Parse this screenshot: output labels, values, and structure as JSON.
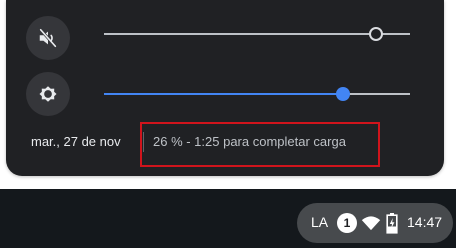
{
  "quick_settings": {
    "volume": {
      "icon": "volume-muted-icon",
      "level": 0.89
    },
    "brightness": {
      "icon": "brightness-icon",
      "level": 0.78
    },
    "date": "mar., 27 de nov",
    "battery_status": "26 % - 1:25 para completar carga",
    "highlight_color": "#d0141c"
  },
  "shelf": {
    "status_area": {
      "input_method": "LA",
      "notification_count": "1",
      "wifi_icon": "wifi-icon",
      "battery_icon": "battery-charging-icon",
      "time": "14:47"
    }
  }
}
